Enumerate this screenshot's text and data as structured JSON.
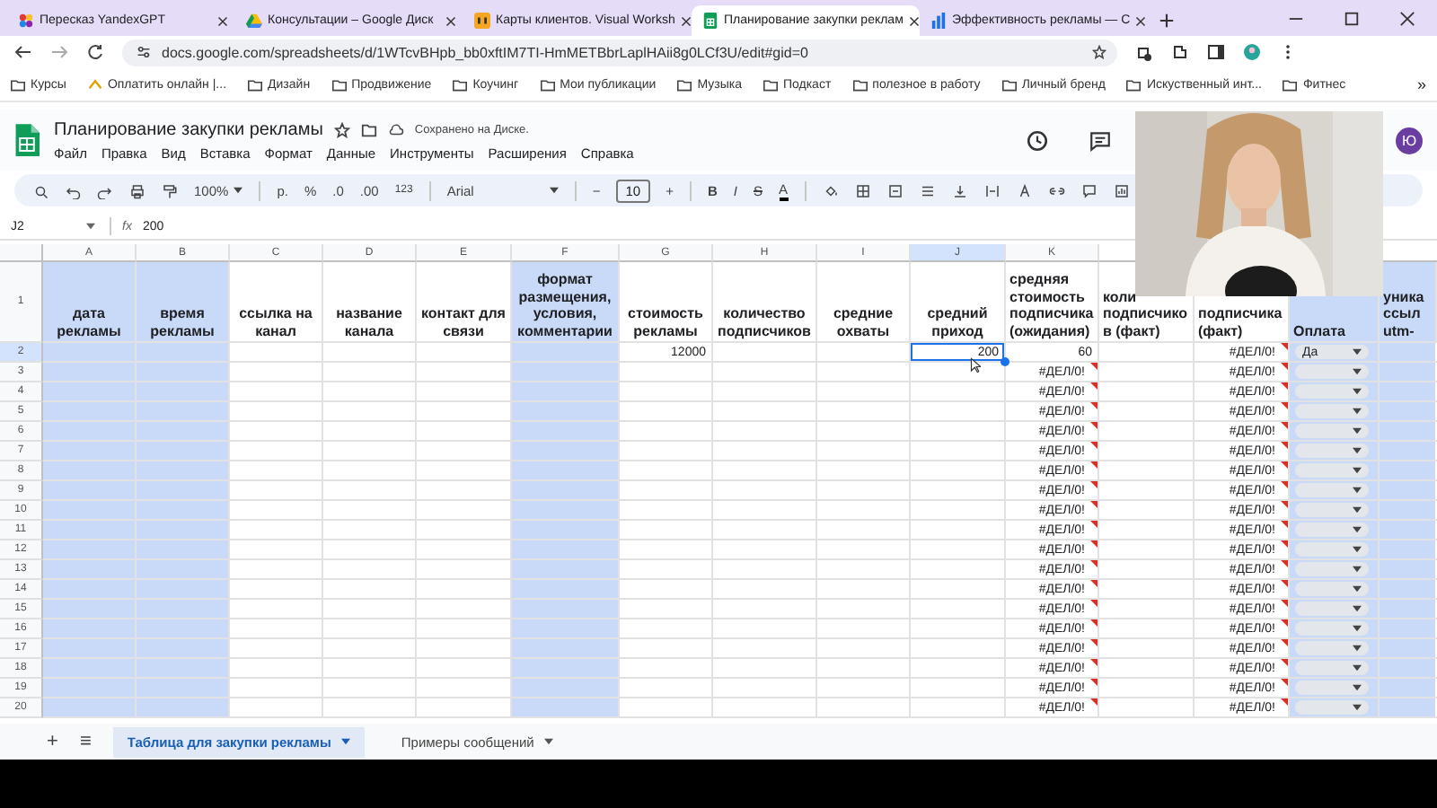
{
  "browser": {
    "tabs": [
      {
        "title": "Пересказ YandexGPT",
        "selected": false
      },
      {
        "title": "Консультации – Google Диск",
        "selected": false
      },
      {
        "title": "Карты клиентов. Visual Worksh",
        "selected": false
      },
      {
        "title": "Планирование закупки реклам",
        "selected": true
      },
      {
        "title": "Эффективность рекламы — С",
        "selected": false
      }
    ],
    "url": "docs.google.com/spreadsheets/d/1WTcvBHpb_bb0xftIM7TI-HmMETBbrLaplHAii8g0LCf3U/edit#gid=0",
    "bookmarks": [
      {
        "label": "Курсы",
        "kind": "folder"
      },
      {
        "label": "Оплатить онлайн |...",
        "kind": "link"
      },
      {
        "label": "Дизайн",
        "kind": "folder"
      },
      {
        "label": "Продвижение",
        "kind": "folder"
      },
      {
        "label": "Коучинг",
        "kind": "folder"
      },
      {
        "label": "Мои публикации",
        "kind": "folder"
      },
      {
        "label": "Музыка",
        "kind": "folder"
      },
      {
        "label": "Подкаст",
        "kind": "folder"
      },
      {
        "label": "полезное в работу",
        "kind": "folder"
      },
      {
        "label": "Личный бренд",
        "kind": "folder"
      },
      {
        "label": "Искуственный инт...",
        "kind": "folder"
      },
      {
        "label": "Фитнес",
        "kind": "folder"
      }
    ],
    "bookmarks_more": "»"
  },
  "sheets": {
    "title": "Планирование закупки рекламы",
    "save_status": "Сохранено на Диске.",
    "menu": [
      "Файл",
      "Правка",
      "Вид",
      "Вставка",
      "Формат",
      "Данные",
      "Инструменты",
      "Расширения",
      "Справка"
    ],
    "avatar": "Ю",
    "toolbar": {
      "zoom": "100%",
      "currency": "р.",
      "percent": "%",
      "decimal_decrease": ".0",
      "decimal_increase": ".00",
      "number_format": "123",
      "font": "Arial",
      "size_minus": "−",
      "font_size": "10",
      "size_plus": "+",
      "bold": "B",
      "italic": "I",
      "strike": "S",
      "text_color": "A"
    },
    "name_box": "J2",
    "fx": "fx",
    "formula": "200"
  },
  "grid": {
    "columns": [
      {
        "letter": "A",
        "header": [
          "дата",
          "рекламы"
        ],
        "highlighted": true,
        "selected": false
      },
      {
        "letter": "B",
        "header": [
          "время",
          "рекламы"
        ],
        "highlighted": true,
        "selected": false
      },
      {
        "letter": "C",
        "header": [
          "ссылка на",
          "канал"
        ],
        "highlighted": false,
        "selected": false
      },
      {
        "letter": "D",
        "header": [
          "название",
          "канала"
        ],
        "highlighted": false,
        "selected": false
      },
      {
        "letter": "E",
        "header": [
          "контакт для",
          "связи"
        ],
        "highlighted": false,
        "selected": false
      },
      {
        "letter": "F",
        "header": [
          "формат",
          "размещения,",
          "условия,",
          "комментарии"
        ],
        "highlighted": true,
        "selected": false
      },
      {
        "letter": "G",
        "header": [
          "стоимость",
          "рекламы"
        ],
        "highlighted": false,
        "selected": false
      },
      {
        "letter": "H",
        "header": [
          "количество",
          "подписчиков"
        ],
        "highlighted": false,
        "selected": false
      },
      {
        "letter": "I",
        "header": [
          "средние",
          "охваты"
        ],
        "highlighted": false,
        "selected": false
      },
      {
        "letter": "J",
        "header": [
          "средний",
          "приход"
        ],
        "highlighted": false,
        "selected": true
      },
      {
        "letter": "K",
        "header": [
          "средняя",
          "стоимость",
          "подписчика",
          "(ожидания)"
        ],
        "highlighted": false,
        "selected": false
      },
      {
        "header": [
          "коли",
          "подписчико",
          "в (факт)"
        ],
        "highlighted": false
      },
      {
        "header": [
          "подписчика",
          "(факт)"
        ],
        "highlighted": false
      },
      {
        "header": [
          "Оплата"
        ],
        "highlighted": true
      },
      {
        "header": [
          "уника",
          "ссыл",
          "utm-"
        ],
        "highlighted": true
      }
    ],
    "header_row": "1",
    "rows": [
      {
        "number": "2",
        "selected": true,
        "dropdown": true,
        "dropdown_value": "Да",
        "cells": [
          "",
          "",
          "",
          "",
          "",
          "",
          {
            "text": "12000",
            "error": false
          },
          "",
          "",
          {
            "text": "200",
            "error": false
          },
          {
            "text": "60",
            "error": false
          },
          "",
          {
            "text": "#ДЕЛ/0!",
            "error": true
          },
          "",
          ""
        ]
      },
      {
        "number": "3",
        "selected": false,
        "dropdown": true,
        "cells": [
          "",
          "",
          "",
          "",
          "",
          "",
          "",
          "",
          "",
          "",
          {
            "text": "#ДЕЛ/0!",
            "error": true
          },
          "",
          {
            "text": "#ДЕЛ/0!",
            "error": true
          },
          "",
          ""
        ]
      },
      {
        "number": "4",
        "selected": false,
        "dropdown": true,
        "cells": [
          "",
          "",
          "",
          "",
          "",
          "",
          "",
          "",
          "",
          "",
          {
            "text": "#ДЕЛ/0!",
            "error": true
          },
          "",
          {
            "text": "#ДЕЛ/0!",
            "error": true
          },
          "",
          ""
        ]
      },
      {
        "number": "5",
        "selected": false,
        "dropdown": true,
        "cells": [
          "",
          "",
          "",
          "",
          "",
          "",
          "",
          "",
          "",
          "",
          {
            "text": "#ДЕЛ/0!",
            "error": true
          },
          "",
          {
            "text": "#ДЕЛ/0!",
            "error": true
          },
          "",
          ""
        ]
      },
      {
        "number": "6",
        "selected": false,
        "dropdown": true,
        "cells": [
          "",
          "",
          "",
          "",
          "",
          "",
          "",
          "",
          "",
          "",
          {
            "text": "#ДЕЛ/0!",
            "error": true
          },
          "",
          {
            "text": "#ДЕЛ/0!",
            "error": true
          },
          "",
          ""
        ]
      },
      {
        "number": "7",
        "selected": false,
        "dropdown": true,
        "cells": [
          "",
          "",
          "",
          "",
          "",
          "",
          "",
          "",
          "",
          "",
          {
            "text": "#ДЕЛ/0!",
            "error": true
          },
          "",
          {
            "text": "#ДЕЛ/0!",
            "error": true
          },
          "",
          ""
        ]
      },
      {
        "number": "8",
        "selected": false,
        "dropdown": true,
        "cells": [
          "",
          "",
          "",
          "",
          "",
          "",
          "",
          "",
          "",
          "",
          {
            "text": "#ДЕЛ/0!",
            "error": true
          },
          "",
          {
            "text": "#ДЕЛ/0!",
            "error": true
          },
          "",
          ""
        ]
      },
      {
        "number": "9",
        "selected": false,
        "dropdown": true,
        "cells": [
          "",
          "",
          "",
          "",
          "",
          "",
          "",
          "",
          "",
          "",
          {
            "text": "#ДЕЛ/0!",
            "error": true
          },
          "",
          {
            "text": "#ДЕЛ/0!",
            "error": true
          },
          "",
          ""
        ]
      },
      {
        "number": "10",
        "selected": false,
        "dropdown": true,
        "cells": [
          "",
          "",
          "",
          "",
          "",
          "",
          "",
          "",
          "",
          "",
          {
            "text": "#ДЕЛ/0!",
            "error": true
          },
          "",
          {
            "text": "#ДЕЛ/0!",
            "error": true
          },
          "",
          ""
        ]
      },
      {
        "number": "11",
        "selected": false,
        "dropdown": true,
        "cells": [
          "",
          "",
          "",
          "",
          "",
          "",
          "",
          "",
          "",
          "",
          {
            "text": "#ДЕЛ/0!",
            "error": true
          },
          "",
          {
            "text": "#ДЕЛ/0!",
            "error": true
          },
          "",
          ""
        ]
      },
      {
        "number": "12",
        "selected": false,
        "dropdown": true,
        "cells": [
          "",
          "",
          "",
          "",
          "",
          "",
          "",
          "",
          "",
          "",
          {
            "text": "#ДЕЛ/0!",
            "error": true
          },
          "",
          {
            "text": "#ДЕЛ/0!",
            "error": true
          },
          "",
          ""
        ]
      },
      {
        "number": "13",
        "selected": false,
        "dropdown": true,
        "cells": [
          "",
          "",
          "",
          "",
          "",
          "",
          "",
          "",
          "",
          "",
          {
            "text": "#ДЕЛ/0!",
            "error": true
          },
          "",
          {
            "text": "#ДЕЛ/0!",
            "error": true
          },
          "",
          ""
        ]
      },
      {
        "number": "14",
        "selected": false,
        "dropdown": true,
        "cells": [
          "",
          "",
          "",
          "",
          "",
          "",
          "",
          "",
          "",
          "",
          {
            "text": "#ДЕЛ/0!",
            "error": true
          },
          "",
          {
            "text": "#ДЕЛ/0!",
            "error": true
          },
          "",
          ""
        ]
      },
      {
        "number": "15",
        "selected": false,
        "dropdown": true,
        "cells": [
          "",
          "",
          "",
          "",
          "",
          "",
          "",
          "",
          "",
          "",
          {
            "text": "#ДЕЛ/0!",
            "error": true
          },
          "",
          {
            "text": "#ДЕЛ/0!",
            "error": true
          },
          "",
          ""
        ]
      },
      {
        "number": "16",
        "selected": false,
        "dropdown": true,
        "cells": [
          "",
          "",
          "",
          "",
          "",
          "",
          "",
          "",
          "",
          "",
          {
            "text": "#ДЕЛ/0!",
            "error": true
          },
          "",
          {
            "text": "#ДЕЛ/0!",
            "error": true
          },
          "",
          ""
        ]
      },
      {
        "number": "17",
        "selected": false,
        "dropdown": true,
        "cells": [
          "",
          "",
          "",
          "",
          "",
          "",
          "",
          "",
          "",
          "",
          {
            "text": "#ДЕЛ/0!",
            "error": true
          },
          "",
          {
            "text": "#ДЕЛ/0!",
            "error": true
          },
          "",
          ""
        ]
      },
      {
        "number": "18",
        "selected": false,
        "dropdown": true,
        "cells": [
          "",
          "",
          "",
          "",
          "",
          "",
          "",
          "",
          "",
          "",
          {
            "text": "#ДЕЛ/0!",
            "error": true
          },
          "",
          {
            "text": "#ДЕЛ/0!",
            "error": true
          },
          "",
          ""
        ]
      },
      {
        "number": "19",
        "selected": false,
        "dropdown": true,
        "cells": [
          "",
          "",
          "",
          "",
          "",
          "",
          "",
          "",
          "",
          "",
          {
            "text": "#ДЕЛ/0!",
            "error": true
          },
          "",
          {
            "text": "#ДЕЛ/0!",
            "error": true
          },
          "",
          ""
        ]
      },
      {
        "number": "20",
        "selected": false,
        "dropdown": true,
        "cells": [
          "",
          "",
          "",
          "",
          "",
          "",
          "",
          "",
          "",
          "",
          {
            "text": "#ДЕЛ/0!",
            "error": true
          },
          "",
          {
            "text": "#ДЕЛ/0!",
            "error": true
          },
          "",
          ""
        ]
      }
    ]
  },
  "sheet_tabs": {
    "add": "+",
    "list": "≡",
    "tabs": [
      {
        "label": "Таблица для закупки рекламы",
        "selected": true
      },
      {
        "label": "Примеры сообщений",
        "selected": false
      }
    ]
  }
}
